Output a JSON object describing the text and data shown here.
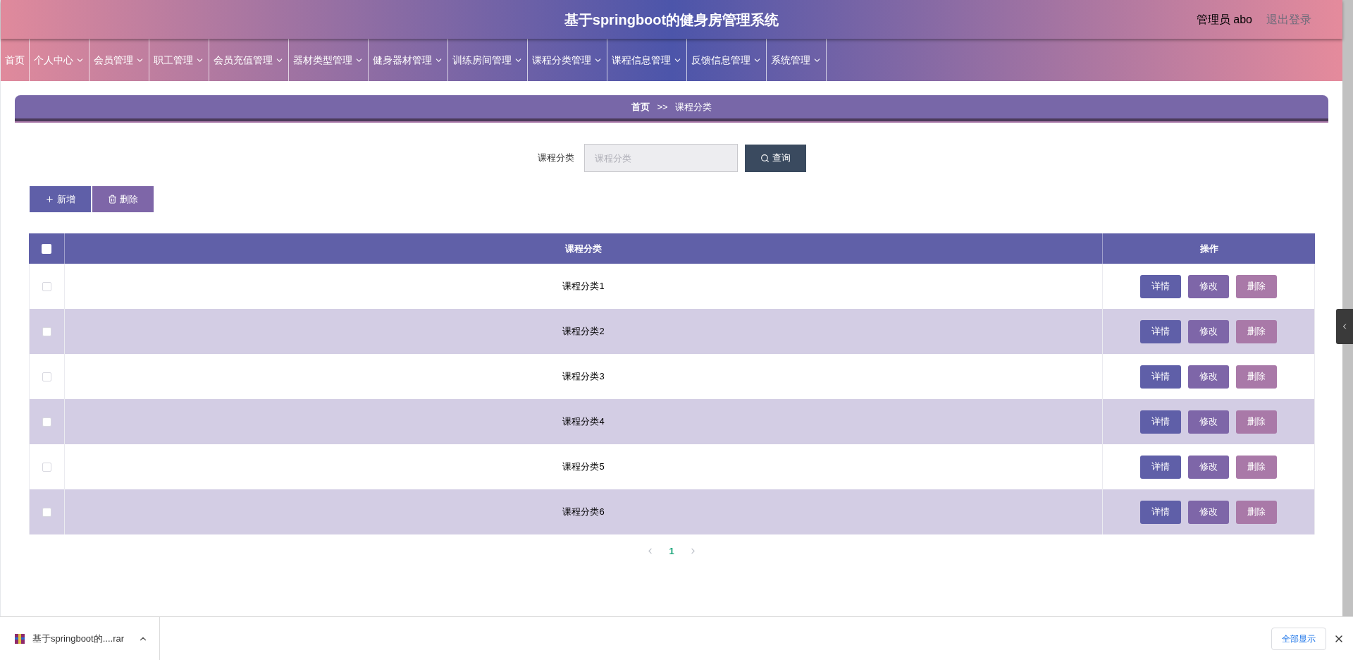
{
  "header": {
    "title": "基于springboot的健身房管理系统",
    "user": "管理员 abo",
    "logout": "退出登录"
  },
  "nav": [
    {
      "label": "首页",
      "dropdown": false
    },
    {
      "label": "个人中心",
      "dropdown": true
    },
    {
      "label": "会员管理",
      "dropdown": true
    },
    {
      "label": "职工管理",
      "dropdown": true
    },
    {
      "label": "会员充值管理",
      "dropdown": true
    },
    {
      "label": "器材类型管理",
      "dropdown": true
    },
    {
      "label": "健身器材管理",
      "dropdown": true
    },
    {
      "label": "训练房间管理",
      "dropdown": true
    },
    {
      "label": "课程分类管理",
      "dropdown": true
    },
    {
      "label": "课程信息管理",
      "dropdown": true
    },
    {
      "label": "反馈信息管理",
      "dropdown": true
    },
    {
      "label": "系统管理",
      "dropdown": true
    }
  ],
  "breadcrumb": {
    "home": "首页",
    "separator": ">>",
    "current": "课程分类"
  },
  "search": {
    "label": "课程分类",
    "placeholder": "课程分类",
    "button": "查询"
  },
  "actions": {
    "add": "新增",
    "delete": "删除"
  },
  "table": {
    "header_checked": false,
    "columns": [
      "课程分类",
      "操作"
    ],
    "rows": [
      {
        "checked": false,
        "name": "课程分类1",
        "buttons": [
          "详情",
          "修改",
          "删除"
        ]
      },
      {
        "checked": false,
        "name": "课程分类2",
        "buttons": [
          "详情",
          "修改",
          "删除"
        ]
      },
      {
        "checked": false,
        "name": "课程分类3",
        "buttons": [
          "详情",
          "修改",
          "删除"
        ]
      },
      {
        "checked": false,
        "name": "课程分类4",
        "buttons": [
          "详情",
          "修改",
          "删除"
        ]
      },
      {
        "checked": false,
        "name": "课程分类5",
        "buttons": [
          "详情",
          "修改",
          "删除"
        ]
      },
      {
        "checked": false,
        "name": "课程分类6",
        "buttons": [
          "详情",
          "修改",
          "删除"
        ]
      }
    ]
  },
  "pagination": {
    "pages": [
      {
        "label": "1",
        "selected": true
      }
    ]
  },
  "download_bar": {
    "file": "基于springboot的....rar",
    "show_all": "全部显示"
  }
}
